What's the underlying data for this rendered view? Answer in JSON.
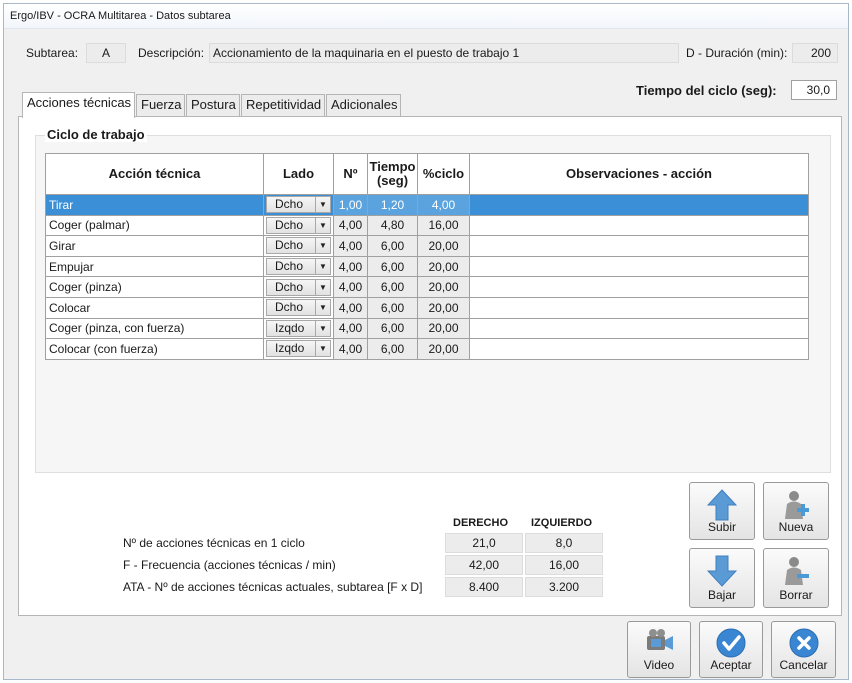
{
  "window": {
    "title": "Ergo/IBV - OCRA Multitarea - Datos subtarea"
  },
  "header": {
    "subtask_label": "Subtarea:",
    "subtask_value": "A",
    "description_label": "Descripción:",
    "description_value": "Accionamiento de la maquinaria en el puesto de trabajo 1",
    "duration_label": "D - Duración (min):",
    "duration_value": "200",
    "cycle_label": "Tiempo del ciclo (seg):",
    "cycle_value": "30,0"
  },
  "tabs": [
    "Acciones técnicas",
    "Fuerza",
    "Postura",
    "Repetitividad",
    "Adicionales"
  ],
  "group_title": "Ciclo de trabajo",
  "table": {
    "headers": [
      "Acción técnica",
      "Lado",
      "Nº",
      "Tiempo (seg)",
      "%ciclo",
      "Observaciones - acción"
    ],
    "rows": [
      {
        "action": "Tirar",
        "side": "Dcho",
        "n": "1,00",
        "time": "1,20",
        "pct": "4,00",
        "obs": ""
      },
      {
        "action": "Coger (palmar)",
        "side": "Dcho",
        "n": "4,00",
        "time": "4,80",
        "pct": "16,00",
        "obs": ""
      },
      {
        "action": "Girar",
        "side": "Dcho",
        "n": "4,00",
        "time": "6,00",
        "pct": "20,00",
        "obs": ""
      },
      {
        "action": "Empujar",
        "side": "Dcho",
        "n": "4,00",
        "time": "6,00",
        "pct": "20,00",
        "obs": ""
      },
      {
        "action": "Coger (pinza)",
        "side": "Dcho",
        "n": "4,00",
        "time": "6,00",
        "pct": "20,00",
        "obs": ""
      },
      {
        "action": "Colocar",
        "side": "Dcho",
        "n": "4,00",
        "time": "6,00",
        "pct": "20,00",
        "obs": ""
      },
      {
        "action": "Coger (pinza, con fuerza)",
        "side": "Izqdo",
        "n": "4,00",
        "time": "6,00",
        "pct": "20,00",
        "obs": ""
      },
      {
        "action": "Colocar (con fuerza)",
        "side": "Izqdo",
        "n": "4,00",
        "time": "6,00",
        "pct": "20,00",
        "obs": ""
      }
    ]
  },
  "summary": {
    "col_right": "DERECHO",
    "col_left": "IZQUIERDO",
    "rows": [
      {
        "label": "Nº de acciones técnicas en 1 ciclo",
        "right": "21,0",
        "left": "8,0"
      },
      {
        "label": "F - Frecuencia (acciones técnicas / min)",
        "right": "42,00",
        "left": "16,00"
      },
      {
        "label": "ATA - Nº de acciones técnicas actuales, subtarea [F x D]",
        "right": "8.400",
        "left": "3.200"
      }
    ]
  },
  "buttons": {
    "up": "Subir",
    "new": "Nueva",
    "down": "Bajar",
    "delete": "Borrar",
    "video": "Video",
    "accept": "Aceptar",
    "cancel": "Cancelar"
  },
  "colors": {
    "selection": "#3b8fd6",
    "arrow_blue": "#5b9bd5",
    "ok_blue": "#3a86d2"
  }
}
